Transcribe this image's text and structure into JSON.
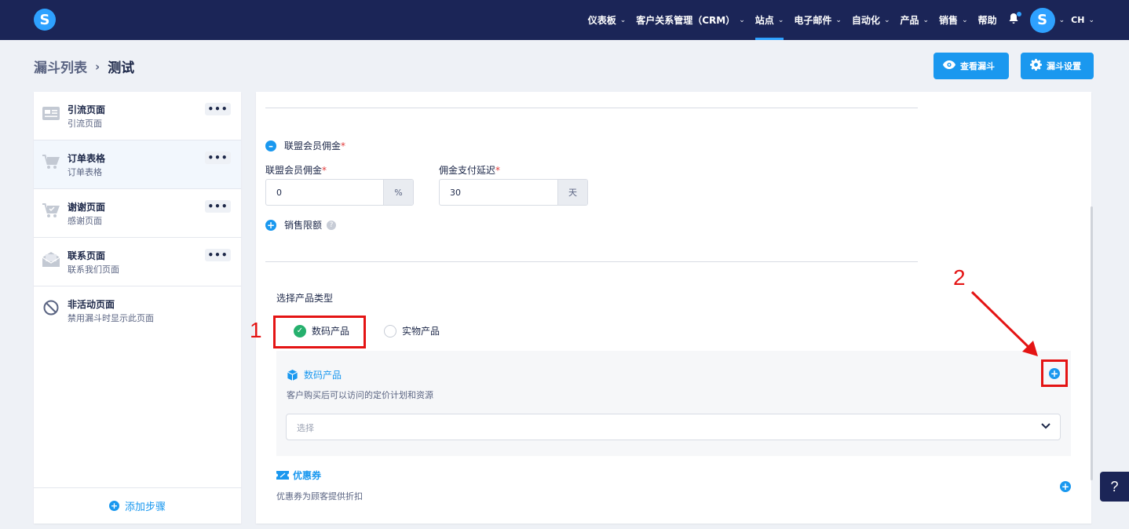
{
  "brand": {
    "logo_letter": "S",
    "accent": "#1a98ef",
    "nav_bg": "#1b2557"
  },
  "nav": {
    "items": [
      {
        "label": "仪表板",
        "has_menu": true
      },
      {
        "label": "客户关系管理（CRM）",
        "has_menu": true
      },
      {
        "label": "站点",
        "has_menu": true,
        "active": true
      },
      {
        "label": "电子邮件",
        "has_menu": true
      },
      {
        "label": "自动化",
        "has_menu": true
      },
      {
        "label": "产品",
        "has_menu": true
      },
      {
        "label": "销售",
        "has_menu": true
      },
      {
        "label": "帮助",
        "has_menu": false
      }
    ],
    "avatar_letter": "S",
    "lang": "CH"
  },
  "breadcrumb": {
    "parent": "漏斗列表",
    "separator": "›",
    "current": "测试"
  },
  "header_buttons": {
    "view_funnel": "查看漏斗",
    "funnel_settings": "漏斗设置"
  },
  "sidebar": {
    "steps": [
      {
        "title": "引流页面",
        "subtitle": "引流页面",
        "icon": "page-icon"
      },
      {
        "title": "订单表格",
        "subtitle": "订单表格",
        "icon": "cart-icon",
        "active": true
      },
      {
        "title": "谢谢页面",
        "subtitle": "感谢页面",
        "icon": "cart-check-icon"
      },
      {
        "title": "联系页面",
        "subtitle": "联系我们页面",
        "icon": "mail-icon"
      }
    ],
    "more_label": "•••",
    "inactive": {
      "title": "非活动页面",
      "subtitle": "禁用漏斗时显示此页面"
    },
    "add_step": "添加步骤"
  },
  "form": {
    "affiliate_toggle": "联盟会员佣金",
    "affiliate_commission_label": "联盟会员佣金",
    "affiliate_commission_value": "0",
    "affiliate_commission_unit": "%",
    "payout_delay_label": "佣金支付延迟",
    "payout_delay_value": "30",
    "payout_delay_unit": "天",
    "sales_limit": "销售限额",
    "product_type_label": "选择产品类型",
    "product_types": [
      {
        "label": "数码产品",
        "selected": true
      },
      {
        "label": "实物产品",
        "selected": false
      }
    ],
    "digital": {
      "title": "数码产品",
      "description": "客户购买后可以访问的定价计划和资源",
      "select_placeholder": "选择"
    },
    "coupon": {
      "title": "优惠券",
      "description": "优惠券为顾客提供折扣"
    }
  },
  "annotations": {
    "label_1": "1",
    "label_2": "2",
    "color": "#e41414"
  },
  "help_fab": "?"
}
